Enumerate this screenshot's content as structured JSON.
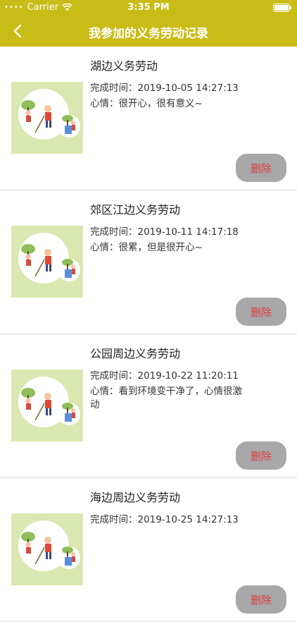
{
  "status_bar": {
    "carrier": "Carrier",
    "time": "3:35 PM",
    "signal_icon": "signal-dots-icon",
    "wifi_icon": "wifi-icon",
    "battery_icon": "battery-icon"
  },
  "navbar": {
    "back_icon": "chevron-left-icon",
    "title": "我参加的义务劳动记录"
  },
  "colors": {
    "header_bg": "#c9bc16",
    "delete_btn_bg": "#a8a8a8",
    "delete_btn_text": "#e33a3a",
    "thumb_bg": "#d9e8b0"
  },
  "records": [
    {
      "title": "湖边义务劳动",
      "time_label": "完成时间：2019-10-05 14:27:13",
      "mood": "心情：很开心，很有意义~",
      "delete_label": "删除"
    },
    {
      "title": "郊区江边义务劳动",
      "time_label": "完成时间：2019-10-11 14:17:18",
      "mood": "心情：很累，但是很开心~",
      "delete_label": "删除"
    },
    {
      "title": "公园周边义务劳动",
      "time_label": "完成时间：2019-10-22 11:20:11",
      "mood": "心情：看到环境变干净了，心情很激动",
      "delete_label": "删除"
    },
    {
      "title": "海边周边义务劳动",
      "time_label": "完成时间：2019-10-25 14:27:13",
      "mood": "",
      "delete_label": "删除"
    }
  ]
}
